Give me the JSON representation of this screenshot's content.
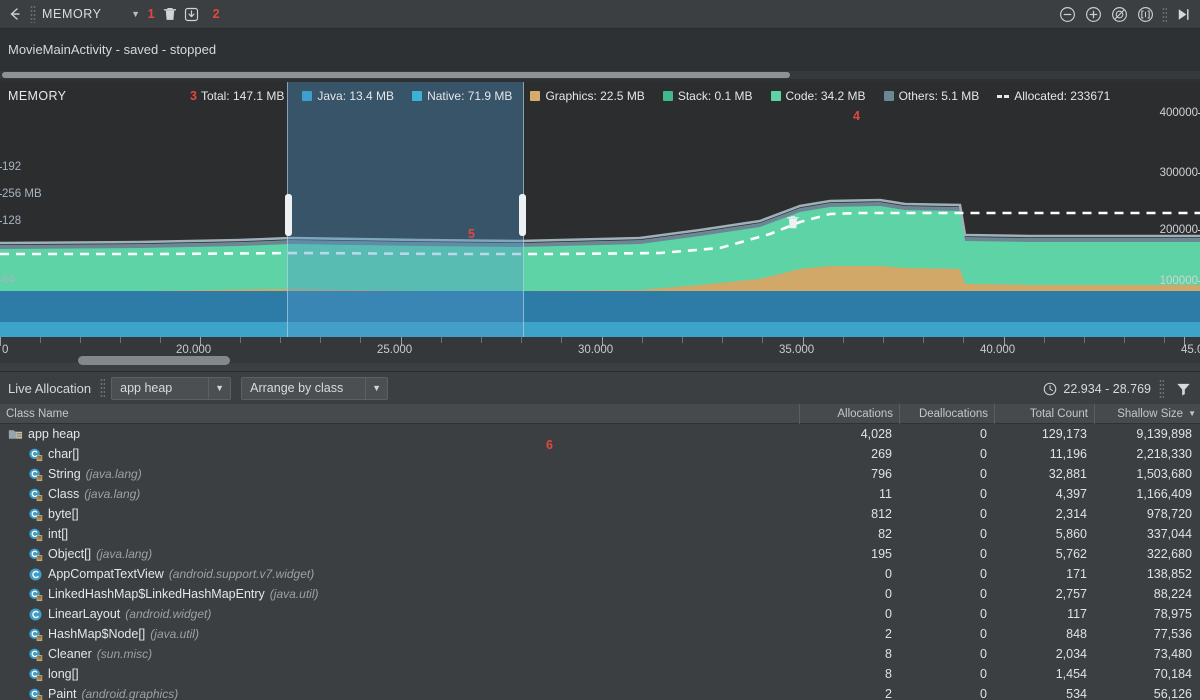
{
  "toolbar": {
    "back_icon": "arrow-left-icon",
    "title": "MEMORY",
    "dropdown_icon": "chevron-down-icon",
    "annotation_1": "1",
    "trash_icon": "trash-icon",
    "export_icon": "download-icon",
    "annotation_2": "2",
    "zoom_out_icon": "zoom-out-icon",
    "zoom_in_icon": "zoom-in-icon",
    "reset_zoom_icon": "reset-zoom-icon",
    "zoom_to_selection_icon": "zoom-to-selection-icon",
    "jump_to_live_icon": "jump-to-end-icon"
  },
  "session": {
    "label": "MovieMainActivity - saved - stopped"
  },
  "chart": {
    "panel_label": "MEMORY",
    "annotation_3": "3",
    "annotation_4": "4",
    "annotation_5": "5",
    "gc_marker_icon": "trash-icon",
    "legend": [
      {
        "name": "Total",
        "value": "Total: 147.1 MB",
        "color": "",
        "swatch": "none"
      },
      {
        "name": "Java",
        "value": "Java: 13.4 MB",
        "color": "#3e9fd0",
        "swatch": "box"
      },
      {
        "name": "Native",
        "value": "Native: 71.9 MB",
        "color": "#3cb3d6",
        "swatch": "box"
      },
      {
        "name": "Graphics",
        "value": "Graphics: 22.5 MB",
        "color": "#d6ab6c",
        "swatch": "box"
      },
      {
        "name": "Stack",
        "value": "Stack: 0.1 MB",
        "color": "#3fba8c",
        "swatch": "box"
      },
      {
        "name": "Code",
        "value": "Code: 34.2 MB",
        "color": "#5ed3a6",
        "swatch": "box"
      },
      {
        "name": "Others",
        "value": "Others: 5.1 MB",
        "color": "#6b8794",
        "swatch": "box"
      },
      {
        "name": "Allocated",
        "value": "Allocated: 233671",
        "color": "#e6e8ea",
        "swatch": "dash"
      }
    ],
    "y_left_labels": [
      "256 MB",
      "192",
      "128",
      "64"
    ],
    "y_right_labels": [
      "400000",
      "300000",
      "200000",
      "100000"
    ],
    "time_labels": [
      "0",
      "20.000",
      "25.000",
      "30.000",
      "35.000",
      "40.000",
      "45.0"
    ]
  },
  "allocation": {
    "title": "Live Allocation",
    "heap_selected": "app heap",
    "arrange_selected": "Arrange by class",
    "clock_icon": "clock-icon",
    "range": "22.934 - 28.769",
    "filter_icon": "filter-icon",
    "annotation_6": "6",
    "columns": [
      "Class Name",
      "Allocations",
      "Deallocations",
      "Total Count",
      "Shallow Size"
    ],
    "sorted_column": "Shallow Size",
    "sort_icon": "sort-desc-icon",
    "rows": [
      {
        "icon": "heap-folder-icon",
        "depth": 0,
        "name": "app heap",
        "pkg": "",
        "allocations": "4,028",
        "deallocations": "0",
        "total_count": "129,173",
        "shallow_size": "9,139,898"
      },
      {
        "icon": "class-array-icon",
        "depth": 1,
        "name": "char[]",
        "pkg": "",
        "allocations": "269",
        "deallocations": "0",
        "total_count": "11,196",
        "shallow_size": "2,218,330"
      },
      {
        "icon": "class-array-icon",
        "depth": 1,
        "name": "String",
        "pkg": "(java.lang)",
        "allocations": "796",
        "deallocations": "0",
        "total_count": "32,881",
        "shallow_size": "1,503,680"
      },
      {
        "icon": "class-array-icon",
        "depth": 1,
        "name": "Class",
        "pkg": "(java.lang)",
        "allocations": "11",
        "deallocations": "0",
        "total_count": "4,397",
        "shallow_size": "1,166,409"
      },
      {
        "icon": "class-array-icon",
        "depth": 1,
        "name": "byte[]",
        "pkg": "",
        "allocations": "812",
        "deallocations": "0",
        "total_count": "2,314",
        "shallow_size": "978,720"
      },
      {
        "icon": "class-array-icon",
        "depth": 1,
        "name": "int[]",
        "pkg": "",
        "allocations": "82",
        "deallocations": "0",
        "total_count": "5,860",
        "shallow_size": "337,044"
      },
      {
        "icon": "class-array-icon",
        "depth": 1,
        "name": "Object[]",
        "pkg": "(java.lang)",
        "allocations": "195",
        "deallocations": "0",
        "total_count": "5,762",
        "shallow_size": "322,680"
      },
      {
        "icon": "class-icon",
        "depth": 1,
        "name": "AppCompatTextView",
        "pkg": "(android.support.v7.widget)",
        "allocations": "0",
        "deallocations": "0",
        "total_count": "171",
        "shallow_size": "138,852"
      },
      {
        "icon": "class-array-icon",
        "depth": 1,
        "name": "LinkedHashMap$LinkedHashMapEntry",
        "pkg": "(java.util)",
        "allocations": "0",
        "deallocations": "0",
        "total_count": "2,757",
        "shallow_size": "88,224"
      },
      {
        "icon": "class-icon",
        "depth": 1,
        "name": "LinearLayout",
        "pkg": "(android.widget)",
        "allocations": "0",
        "deallocations": "0",
        "total_count": "117",
        "shallow_size": "78,975"
      },
      {
        "icon": "class-array-icon",
        "depth": 1,
        "name": "HashMap$Node[]",
        "pkg": "(java.util)",
        "allocations": "2",
        "deallocations": "0",
        "total_count": "848",
        "shallow_size": "77,536"
      },
      {
        "icon": "class-array-icon",
        "depth": 1,
        "name": "Cleaner",
        "pkg": "(sun.misc)",
        "allocations": "8",
        "deallocations": "0",
        "total_count": "2,034",
        "shallow_size": "73,480"
      },
      {
        "icon": "class-array-icon",
        "depth": 1,
        "name": "long[]",
        "pkg": "",
        "allocations": "8",
        "deallocations": "0",
        "total_count": "1,454",
        "shallow_size": "70,184"
      },
      {
        "icon": "class-array-icon",
        "depth": 1,
        "name": "Paint",
        "pkg": "(android.graphics)",
        "allocations": "2",
        "deallocations": "0",
        "total_count": "534",
        "shallow_size": "56,126"
      }
    ]
  },
  "chart_data": {
    "type": "area",
    "title": "Memory",
    "xlabel": "",
    "ylabel": "MB",
    "xlim": [
      17.5,
      45.5
    ],
    "ylim": [
      0,
      256
    ],
    "y2lim": [
      0,
      440000
    ],
    "grid": false,
    "legend_position": "top",
    "x_ticks": [
      20.0,
      25.0,
      30.0,
      35.0,
      40.0,
      45.0
    ],
    "y_ticks_left": [
      64,
      128,
      192,
      256
    ],
    "y_ticks_right": [
      100000,
      200000,
      300000,
      400000
    ],
    "series": [
      {
        "name": "Java",
        "color": "#3e9fd0",
        "current_mb": 13.4
      },
      {
        "name": "Native",
        "color": "#3cb3d6",
        "current_mb": 71.9
      },
      {
        "name": "Graphics",
        "color": "#d6ab6c",
        "current_mb": 22.5
      },
      {
        "name": "Stack",
        "color": "#3fba8c",
        "current_mb": 0.1
      },
      {
        "name": "Code",
        "color": "#5ed3a6",
        "current_mb": 34.2
      },
      {
        "name": "Others",
        "color": "#6b8794",
        "current_mb": 5.1
      },
      {
        "name": "Total",
        "color": "#ffffff",
        "current_mb": 147.1
      },
      {
        "name": "Allocated",
        "color": "#e6e8ea",
        "current_objects": 233671,
        "style": "dashed"
      }
    ],
    "selection_range": [
      22.934,
      28.769
    ],
    "gc_events": [
      34.6
    ]
  }
}
